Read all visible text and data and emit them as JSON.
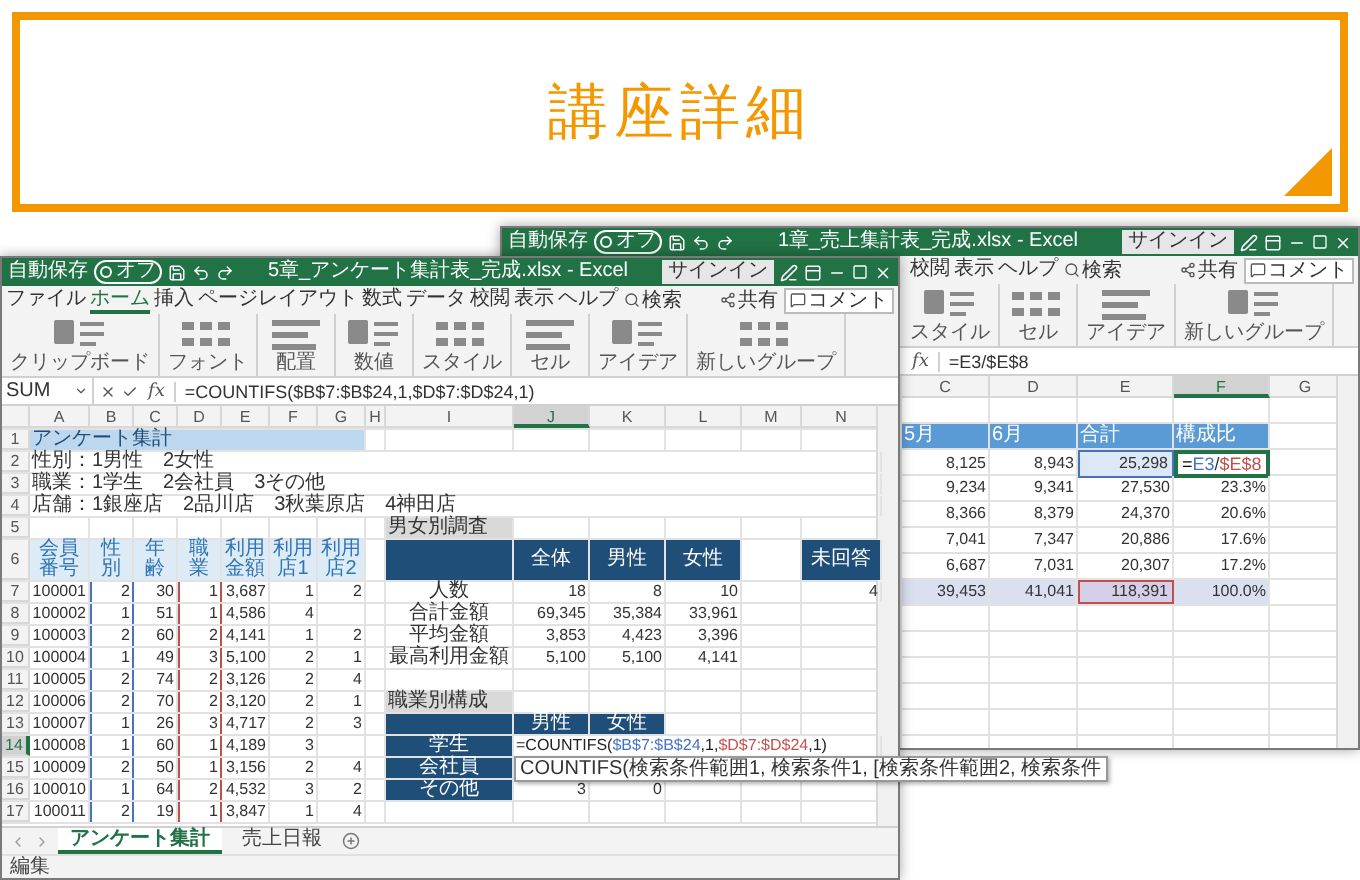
{
  "banner": {
    "title": "講座詳細"
  },
  "back_window": {
    "autosave_label": "自動保存",
    "autosave": {
      "label": "オフ",
      "on": false
    },
    "title": "1章_売上集計表_完成.xlsx - Excel",
    "signin": "サインイン",
    "tabs": [
      {
        "label": "校閲",
        "selected": false
      },
      {
        "label": "表示",
        "selected": false
      },
      {
        "label": "ヘルプ",
        "selected": false
      }
    ],
    "search": "検索",
    "share": "共有",
    "comment": "コメント",
    "ribbon_groups": [
      {
        "label": "スタイル"
      },
      {
        "label": "セル"
      },
      {
        "label": "アイデア"
      },
      {
        "label": "新しいグループ"
      }
    ],
    "fx": "fx",
    "formula": "=E3/$E$8",
    "columns": [
      {
        "letter": "C",
        "selected": false
      },
      {
        "letter": "D",
        "selected": false
      },
      {
        "letter": "E",
        "selected": false
      },
      {
        "letter": "F",
        "selected": true
      },
      {
        "letter": "G",
        "selected": false
      }
    ],
    "rows": [
      {
        "kind": "header",
        "cells": [
          "5月",
          "6月",
          "合計",
          "構成比"
        ]
      },
      {
        "kind": "data",
        "cells": [
          "8,125",
          "8,943",
          {
            "text": "25,298",
            "color": "#4472c4"
          },
          {
            "kind": "editing",
            "parts": [
              {
                "text": "=",
                "color": "#000000"
              },
              {
                "text": "E3",
                "color": "#4472c4"
              },
              {
                "text": "/",
                "color": "#333333"
              },
              {
                "text": "$E$8",
                "color": "#c0504d"
              }
            ]
          }
        ]
      },
      {
        "kind": "data",
        "cells": [
          "9,234",
          "9,341",
          "27,530",
          "23.3%"
        ]
      },
      {
        "kind": "data",
        "cells": [
          "8,366",
          "8,379",
          "24,370",
          "20.6%"
        ]
      },
      {
        "kind": "data",
        "cells": [
          "7,041",
          "7,347",
          "20,886",
          "17.6%"
        ]
      },
      {
        "kind": "data",
        "cells": [
          "6,687",
          "7,031",
          "20,307",
          "17.2%"
        ]
      },
      {
        "kind": "total",
        "cells": [
          "39,453",
          "41,041",
          {
            "text": "118,391",
            "color": "#c0504d"
          },
          "100.0%"
        ]
      }
    ]
  },
  "front_window": {
    "autosave_label": "自動保存",
    "autosave": {
      "label": "オフ",
      "on": false
    },
    "title": "5章_アンケート集計表_完成.xlsx - Excel",
    "signin": "サインイン",
    "tabs": [
      {
        "label": "ファイル",
        "selected": false
      },
      {
        "label": "ホーム",
        "selected": true
      },
      {
        "label": "挿入",
        "selected": false
      },
      {
        "label": "ページレイアウト",
        "selected": false
      },
      {
        "label": "数式",
        "selected": false
      },
      {
        "label": "データ",
        "selected": false
      },
      {
        "label": "校閲",
        "selected": false
      },
      {
        "label": "表示",
        "selected": false
      },
      {
        "label": "ヘルプ",
        "selected": false
      }
    ],
    "search": "検索",
    "share": "共有",
    "comment": "コメント",
    "ribbon_groups": [
      {
        "label": "クリップボード"
      },
      {
        "label": "フォント"
      },
      {
        "label": "配置"
      },
      {
        "label": "数値"
      },
      {
        "label": "スタイル"
      },
      {
        "label": "セル"
      },
      {
        "label": "アイデア"
      },
      {
        "label": "新しいグループ"
      }
    ],
    "name_box": "SUM",
    "fx": "fx",
    "formula": "=COUNTIFS($B$7:$B$24,1,$D$7:$D$24,1)",
    "columns": [
      {
        "letter": "A",
        "selected": false
      },
      {
        "letter": "B",
        "selected": false,
        "color": "#4472c4"
      },
      {
        "letter": "C",
        "selected": false
      },
      {
        "letter": "D",
        "selected": false,
        "color": "#c0504d"
      },
      {
        "letter": "E",
        "selected": false
      },
      {
        "letter": "F",
        "selected": false
      },
      {
        "letter": "G",
        "selected": false
      },
      {
        "letter": "H",
        "selected": false
      },
      {
        "letter": "I",
        "selected": false
      },
      {
        "letter": "J",
        "selected": true
      },
      {
        "letter": "K",
        "selected": false
      },
      {
        "letter": "L",
        "selected": false
      },
      {
        "letter": "M",
        "selected": false
      },
      {
        "letter": "N",
        "selected": false
      }
    ],
    "rows": [
      {
        "num": "1",
        "selected": false,
        "cells": [
          {
            "kind": "title",
            "text": "アンケート集計"
          }
        ]
      },
      {
        "num": "2",
        "selected": false,
        "cells": [
          {
            "kind": "text",
            "text": "性別：1男性　2女性"
          }
        ]
      },
      {
        "num": "3",
        "selected": false,
        "cells": [
          {
            "kind": "text",
            "text": "職業：1学生　2会社員　3その他"
          }
        ]
      },
      {
        "num": "4",
        "selected": false,
        "cells": [
          {
            "kind": "text",
            "text": "店舗：1銀座店　2品川店　3秋葉原店　4神田店"
          }
        ]
      },
      {
        "num": "5",
        "selected": false,
        "cells": [
          null,
          null,
          null,
          null,
          null,
          null,
          null,
          null,
          {
            "kind": "section",
            "text": "男女別調査"
          }
        ]
      },
      {
        "num": "6",
        "selected": false,
        "cells": [
          {
            "kind": "colhead",
            "text": "会員番号"
          },
          {
            "kind": "colhead",
            "text": "性別"
          },
          {
            "kind": "colhead",
            "text": "年齢"
          },
          {
            "kind": "colhead",
            "text": "職業"
          },
          {
            "kind": "colhead",
            "text": "利用金額"
          },
          {
            "kind": "colhead",
            "text": "利用店1"
          },
          {
            "kind": "colhead",
            "text": "利用店2"
          },
          null,
          {
            "kind": "head"
          },
          {
            "kind": "head",
            "text": "全体"
          },
          {
            "kind": "head",
            "text": "男性"
          },
          {
            "kind": "head",
            "text": "女性"
          },
          null,
          {
            "kind": "head",
            "text": "未回答"
          }
        ]
      },
      {
        "num": "7",
        "selected": false,
        "cells": [
          "100001",
          "2",
          "30",
          "1",
          "3,687",
          "1",
          "2",
          null,
          {
            "kind": "label",
            "text": "人数"
          },
          "18",
          "8",
          "10",
          null,
          "4"
        ]
      },
      {
        "num": "8",
        "selected": false,
        "cells": [
          "100002",
          "1",
          "51",
          "1",
          "4,586",
          "4",
          null,
          null,
          {
            "kind": "label",
            "text": "合計金額"
          },
          "69,345",
          "35,384",
          "33,961"
        ]
      },
      {
        "num": "9",
        "selected": false,
        "cells": [
          "100003",
          "2",
          "60",
          "2",
          "4,141",
          "1",
          "2",
          null,
          {
            "kind": "label",
            "text": "平均金額"
          },
          "3,853",
          "4,423",
          "3,396"
        ]
      },
      {
        "num": "10",
        "selected": false,
        "cells": [
          "100004",
          "1",
          "49",
          "3",
          "5,100",
          "2",
          "1",
          null,
          {
            "kind": "label",
            "text": "最高利用金額"
          },
          "5,100",
          "5,100",
          "4,141"
        ]
      },
      {
        "num": "11",
        "selected": false,
        "cells": [
          "100005",
          "2",
          "74",
          "2",
          "3,126",
          "2",
          "4"
        ]
      },
      {
        "num": "12",
        "selected": false,
        "cells": [
          "100006",
          "2",
          "70",
          "2",
          "3,120",
          "2",
          "1",
          null,
          {
            "kind": "section",
            "text": "職業別構成"
          }
        ]
      },
      {
        "num": "13",
        "selected": false,
        "cells": [
          "100007",
          "1",
          "26",
          "3",
          "4,717",
          "2",
          "3",
          null,
          {
            "kind": "head"
          },
          {
            "kind": "head",
            "text": "男性"
          },
          {
            "kind": "head",
            "text": "女性"
          }
        ]
      },
      {
        "num": "14",
        "selected": true,
        "cells": [
          "100008",
          "1",
          "60",
          "1",
          "4,189",
          "3",
          null,
          null,
          {
            "kind": "head",
            "text": "学生"
          },
          {
            "kind": "formula",
            "parts": [
              {
                "text": "=COUNTIFS(",
                "color": "#222222"
              },
              {
                "text": "$B$7:$B$24",
                "color": "#4472c4"
              },
              {
                "text": ",1,",
                "color": "#222222"
              },
              {
                "text": "$D$7:$D$24",
                "color": "#c0504d"
              },
              {
                "text": ",1)",
                "color": "#222222"
              }
            ],
            "tooltip": "COUNTIFS(検索条件範囲1, 検索条件1, [検索条件範囲2, 検索条件"
          }
        ]
      },
      {
        "num": "15",
        "selected": false,
        "cells": [
          "100009",
          "2",
          "50",
          "1",
          "3,156",
          "2",
          "4",
          null,
          {
            "kind": "head",
            "text": "会社員"
          }
        ]
      },
      {
        "num": "16",
        "selected": false,
        "cells": [
          "100010",
          "1",
          "64",
          "2",
          "4,532",
          "3",
          "2",
          null,
          {
            "kind": "head",
            "text": "その他"
          },
          "3",
          "0"
        ]
      },
      {
        "num": "17",
        "selected": false,
        "cells": [
          "100011",
          "2",
          "19",
          "1",
          "3,847",
          "1",
          "4"
        ]
      }
    ],
    "sheets": [
      {
        "label": "アンケート集計",
        "selected": true
      },
      {
        "label": "売上日報",
        "selected": false
      }
    ],
    "status": "編集"
  }
}
